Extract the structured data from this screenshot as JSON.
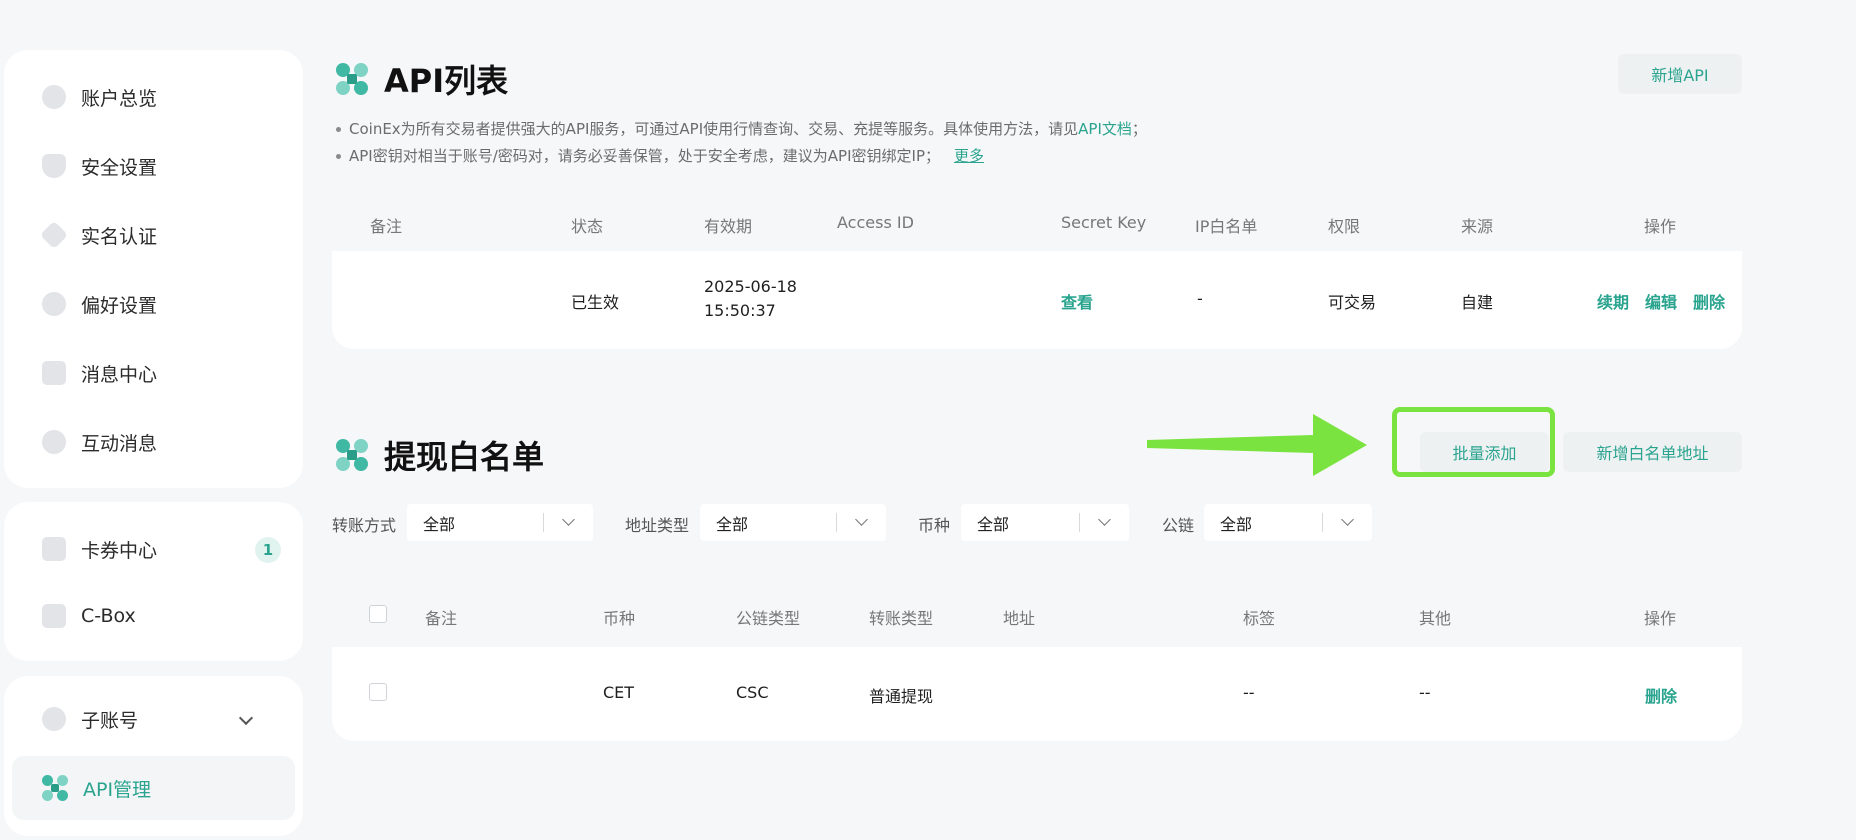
{
  "sidebar": {
    "group1": [
      {
        "label": "账户总览",
        "icon": "pie-chart-icon"
      },
      {
        "label": "安全设置",
        "icon": "shield-icon"
      },
      {
        "label": "实名认证",
        "icon": "id-diamond-icon"
      },
      {
        "label": "偏好设置",
        "icon": "gear-icon"
      },
      {
        "label": "消息中心",
        "icon": "message-box-icon"
      },
      {
        "label": "互动消息",
        "icon": "chat-bubble-icon"
      }
    ],
    "group2": [
      {
        "label": "卡券中心",
        "icon": "coupon-icon",
        "badge": "1"
      },
      {
        "label": "C-Box",
        "icon": "box-icon"
      }
    ],
    "group3": [
      {
        "label": "子账号",
        "icon": "sub-account-icon"
      },
      {
        "label": "API管理",
        "icon": "api-icon"
      }
    ]
  },
  "api_section": {
    "title": "API列表",
    "add_button": "新增API",
    "note1_text": "CoinEx为所有交易者提供强大的API服务，可通过API使用行情查询、交易、充提等服务。具体使用方法，请见",
    "note1_link": "API文档",
    "note1_end": "；",
    "note2_text": "API密钥对相当于账号/密码对，请务必妥善保管，处于安全考虑，建议为API密钥绑定IP；",
    "note2_link": "更多",
    "columns": [
      "备注",
      "状态",
      "有效期",
      "Access ID",
      "Secret Key",
      "IP白名单",
      "权限",
      "来源",
      "操作"
    ],
    "row": {
      "note": "",
      "status": "已生效",
      "expiry_date": "2025-06-18",
      "expiry_time": "15:50:37",
      "access_id": "",
      "secret_key": "查看",
      "ip_whitelist": "-",
      "permission": "可交易",
      "source": "自建",
      "actions": [
        "续期",
        "编辑",
        "删除"
      ]
    }
  },
  "whitelist_section": {
    "title": "提现白名单",
    "batch_add_button": "批量添加",
    "add_address_button": "新增白名单地址",
    "filters": [
      {
        "label": "转账方式",
        "value": "全部"
      },
      {
        "label": "地址类型",
        "value": "全部"
      },
      {
        "label": "币种",
        "value": "全部"
      },
      {
        "label": "公链",
        "value": "全部"
      }
    ],
    "columns": [
      "备注",
      "币种",
      "公链类型",
      "转账类型",
      "地址",
      "标签",
      "其他",
      "操作"
    ],
    "row": {
      "note": "",
      "coin": "CET",
      "chain": "CSC",
      "transfer_type": "普通提现",
      "address": "",
      "tag": "--",
      "other": "--",
      "action": "删除"
    }
  },
  "colors": {
    "accent": "#2aa48f",
    "highlight": "#7be33f",
    "background": "#f6f7f9"
  }
}
